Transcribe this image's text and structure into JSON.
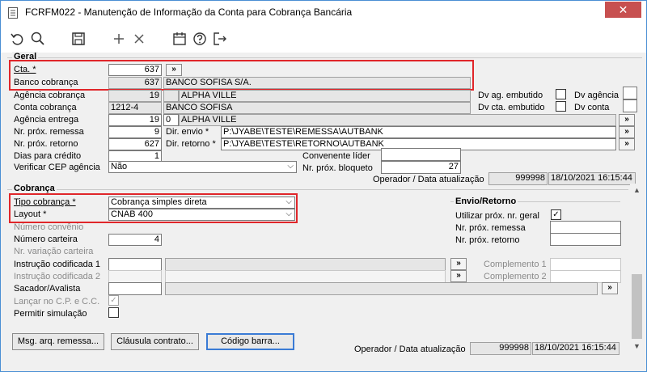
{
  "window": {
    "title": "FCRFM022 - Manutenção de Informação da Conta para Cobrança Bancária",
    "close_glyph": "✕"
  },
  "toolbar": {
    "icons": [
      "undo-icon",
      "search-icon",
      "save-icon",
      "add-icon",
      "delete-icon",
      "calendar-icon",
      "help-icon",
      "exit-icon"
    ]
  },
  "geral": {
    "title": "Geral",
    "cta_label": "Cta. *",
    "cta_value": "637",
    "banco_cobranca_label": "Banco cobrança",
    "banco_cobranca_code": "637",
    "banco_cobranca_name": "BANCO SOFISA S/A.",
    "agencia_cobranca_label": "Agência cobrança",
    "agencia_cobranca_code": "19",
    "agencia_cobranca_name": "ALPHA VILLE",
    "conta_cobranca_label": "Conta cobrança",
    "conta_cobranca_value": "1212-4",
    "conta_cobranca_name": "BANCO SOFISA",
    "agencia_entrega_label": "Agência entrega",
    "agencia_entrega_code": "19",
    "agencia_entrega_dv": "0",
    "agencia_entrega_name": "ALPHA VILLE",
    "nr_prox_remessa_label": "Nr. próx. remessa",
    "nr_prox_remessa_value": "9",
    "nr_prox_retorno_label": "Nr. próx. retorno",
    "nr_prox_retorno_value": "627",
    "dias_credito_label": "Dias para crédito",
    "dias_credito_value": "1",
    "verificar_cep_label": "Verificar CEP agência",
    "verificar_cep_value": "Não",
    "dv_ag_embutido_label": "Dv ag. embutido",
    "dv_agencia_label": "Dv agência",
    "dv_cta_embutido_label": "Dv cta. embutido",
    "dv_conta_label": "Dv conta",
    "dir_envio_label": "Dir. envio *",
    "dir_envio_value": "P:\\JYABE\\TESTE\\REMESSA\\AUTBANK",
    "dir_retorno_label": "Dir. retorno *",
    "dir_retorno_value": "P:\\JYABE\\TESTE\\RETORNO\\AUTBANK",
    "convenente_lider_label": "Convenente líder",
    "nr_prox_bloqueto_label": "Nr. próx. bloqueto",
    "nr_prox_bloqueto_value": "27",
    "operador_label": "Operador / Data atualização",
    "operador_value": "999998",
    "data_value": "18/10/2021 16:15:44"
  },
  "cobranca": {
    "title": "Cobrança",
    "tipo_cobranca_label": "Tipo cobrança *",
    "tipo_cobranca_value": "Cobrança simples direta",
    "layout_label": "Layout *",
    "layout_value": "CNAB 400",
    "numero_convenio_label": "Número convênio",
    "numero_carteira_label": "Número carteira",
    "numero_carteira_value": "4",
    "nr_variacao_label": "Nr. variação carteira",
    "instrucao1_label": "Instrução codificada 1",
    "instrucao2_label": "Instrução codificada 2",
    "complemento1_label": "Complemento 1",
    "complemento2_label": "Complemento 2",
    "sacador_label": "Sacador/Avalista",
    "lancar_label": "Lançar no C.P. e C.C.",
    "permitir_label": "Permitir simulação",
    "envio_retorno_title": "Envio/Retorno",
    "utilizar_prox_label": "Utilizar próx. nr. geral",
    "env_nr_prox_remessa_label": "Nr. próx. remessa",
    "env_nr_prox_retorno_label": "Nr. próx. retorno",
    "msg_button": "Msg. arq. remessa...",
    "clausula_button": "Cláusula contrato...",
    "codigo_button": "Código barra...",
    "operador_label": "Operador / Data atualização",
    "operador_value": "999998",
    "data_value": "18/10/2021 16:15:44"
  },
  "glyphs": {
    "more": "»",
    "dropdown": "⌵",
    "check": "✓",
    "scroll_up": "▲",
    "scroll_down": "▼"
  }
}
